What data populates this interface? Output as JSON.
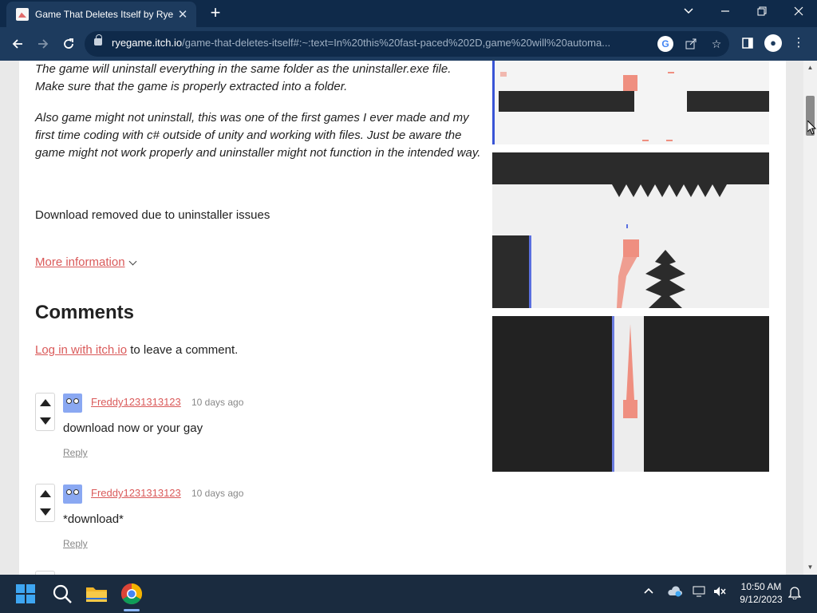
{
  "browser": {
    "tab_title": "Game That Deletes Itself by Rye",
    "tab_close": "✕",
    "new_tab": "+",
    "url_host": "ryegame.itch.io",
    "url_path": "/game-that-deletes-itself#:~:text=In%20this%20fast-paced%202D,game%20will%20automa...",
    "window_controls": [
      "chevron-down",
      "minimize",
      "restore",
      "close"
    ]
  },
  "page": {
    "paragraph1": "The game will uninstall everything in the same folder as the uninstaller.exe file.  Make sure that the game is properly extracted into a folder.",
    "paragraph2": "Also game might not uninstall, this was one of the first games I ever made  and my first time coding with c# outside of unity and working with files.  Just be aware the game might not work properly and uninstaller might not function in the intended way.",
    "download_note": "Download removed due to uninstaller issues",
    "more_information": "More information",
    "comments_heading": "Comments",
    "login_link": "Log in with itch.io",
    "login_suffix": " to leave a comment."
  },
  "comments": [
    {
      "author": "Freddy1231313123",
      "date": "10 days ago",
      "text": "download now or your gay",
      "reply": "Reply"
    },
    {
      "author": "Freddy1231313123",
      "date": "10 days ago",
      "text": "*download*",
      "reply": "Reply"
    }
  ],
  "taskbar": {
    "time": "10:50 AM",
    "date": "9/12/2023"
  },
  "colors": {
    "accent_link": "#da5a5a",
    "chrome_dark": "#0f2a4a",
    "chrome_mid": "#1d3b5e"
  }
}
